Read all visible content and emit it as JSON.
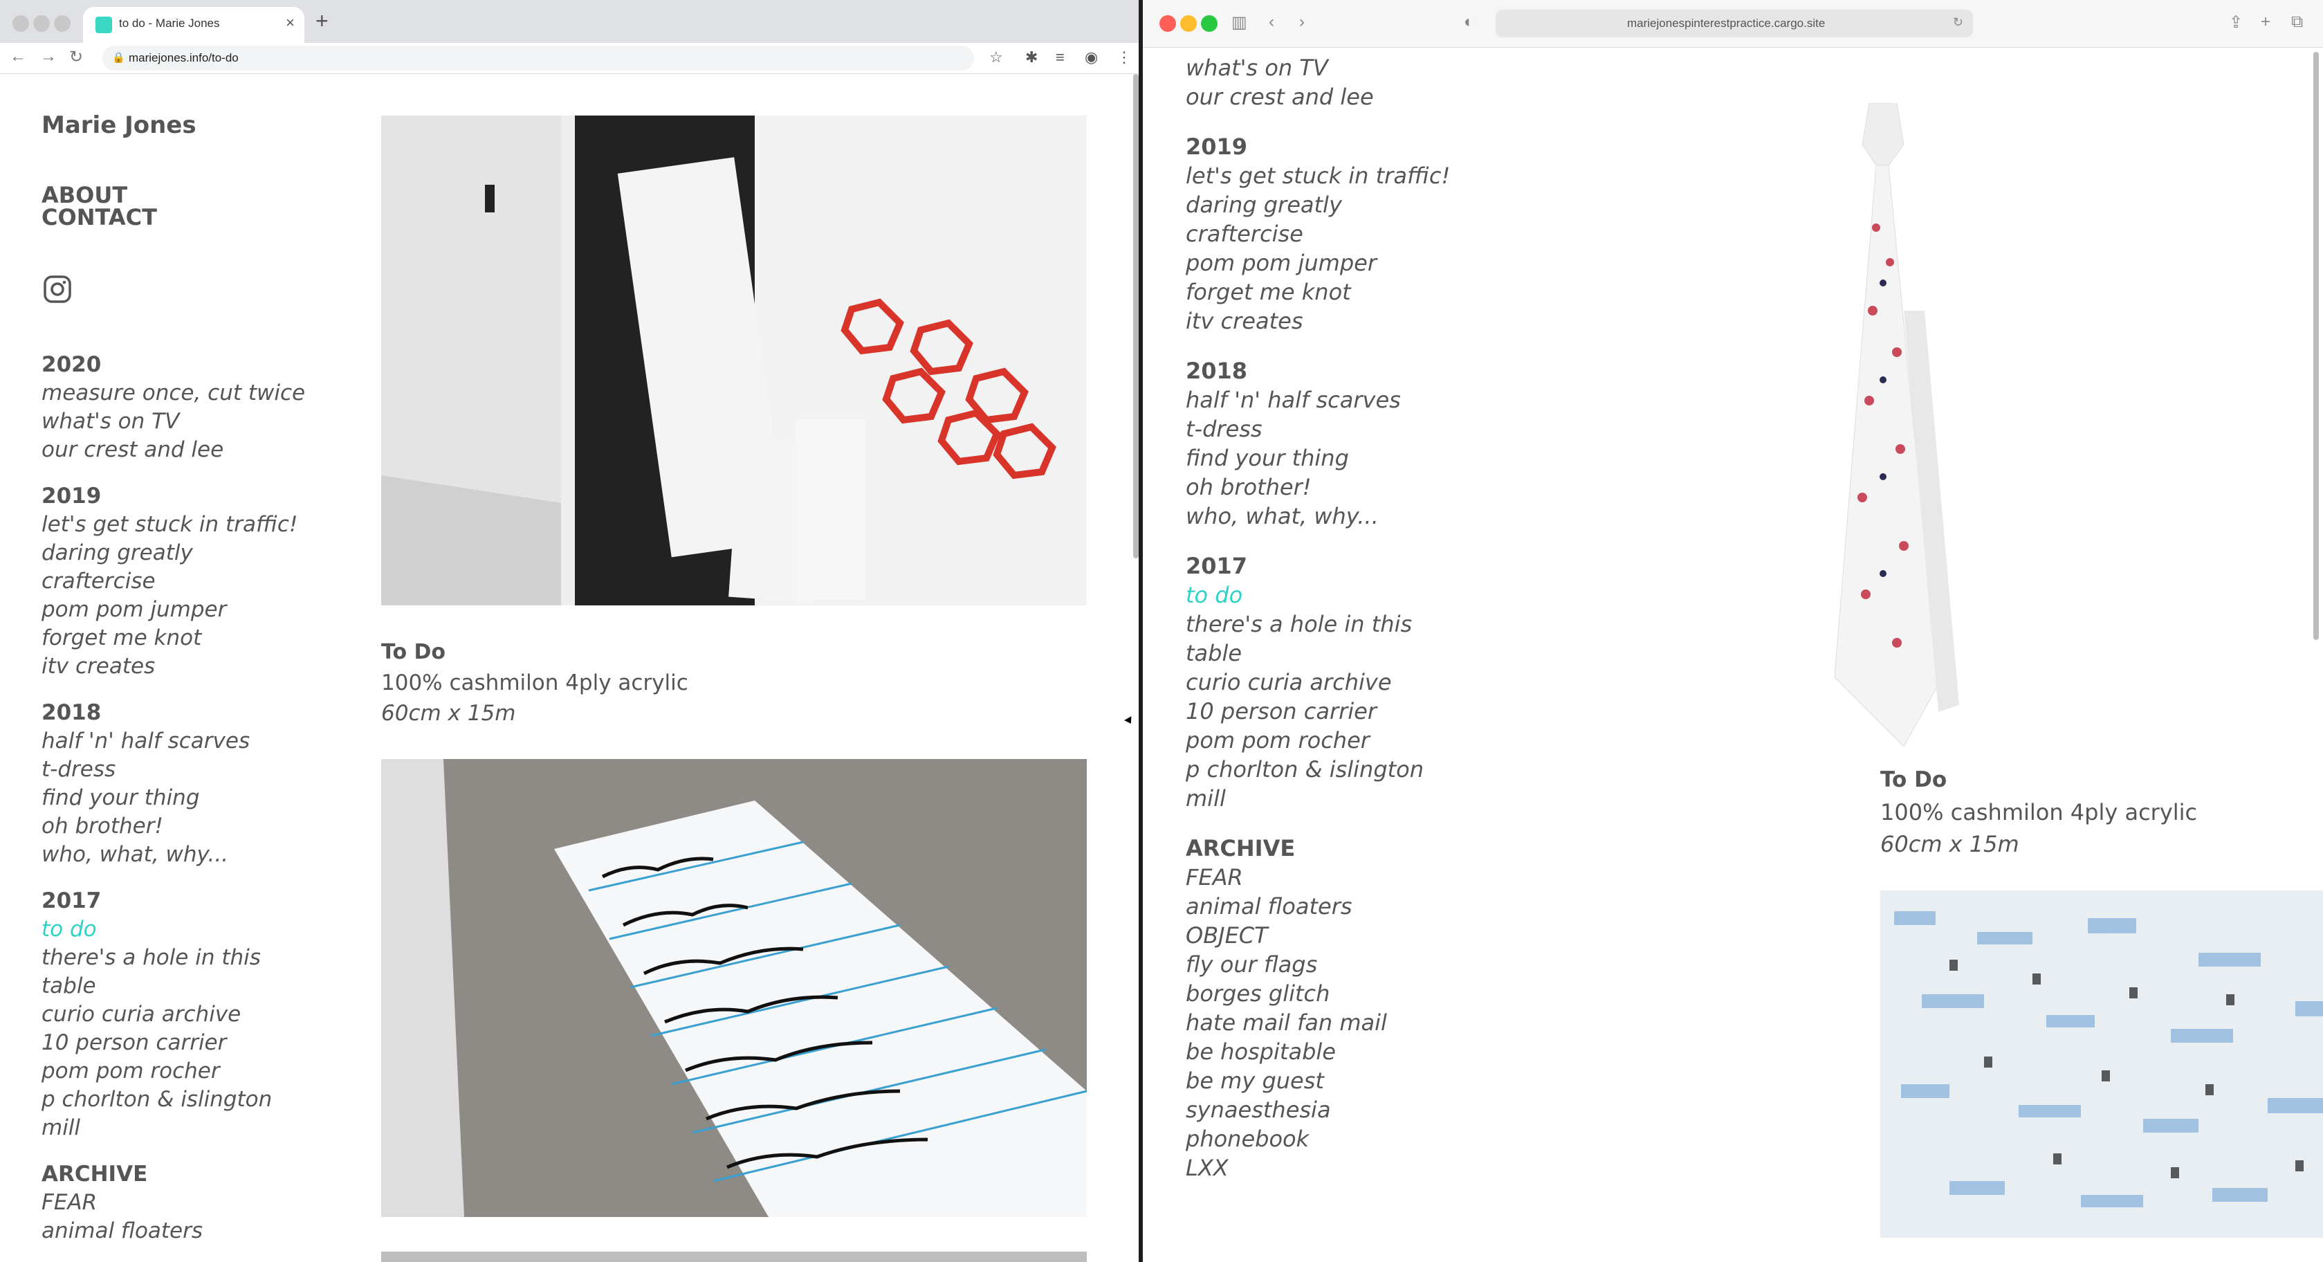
{
  "left_browser": {
    "tab_title": "to do - Marie Jones",
    "url": "mariejones.info/to-do"
  },
  "right_browser": {
    "url": "mariejonespinterestpractice.cargo.site"
  },
  "site": {
    "title": "Marie Jones",
    "nav": [
      "ABOUT",
      "CONTACT"
    ],
    "instagram_icon": "instagram-icon"
  },
  "sidebar_left": {
    "y2020": "2020",
    "items2020": [
      "measure once, cut twice",
      "what's on TV",
      "our crest and lee"
    ],
    "y2019": "2019",
    "items2019": [
      "let's get stuck in traffic!",
      "daring greatly",
      "craftercise",
      "pom pom jumper",
      "forget me knot",
      "itv creates"
    ],
    "y2018": "2018",
    "items2018": [
      "half 'n' half scarves",
      "t-dress",
      "find your thing",
      "oh brother!",
      "who, what, why..."
    ],
    "y2017": "2017",
    "items2017": [
      "to do",
      "there's a hole in this",
      "table",
      "curio curia archive",
      "10 person carrier",
      "pom pom rocher",
      "p chorlton & islington",
      "mill"
    ],
    "archive": "ARCHIVE",
    "archive_items": [
      "FEAR",
      "animal floaters"
    ]
  },
  "sidebar_right": {
    "items_top": [
      "what's on TV",
      "our crest and lee"
    ],
    "archive_items": [
      "FEAR",
      "animal floaters",
      "OBJECT",
      "fly our flags",
      "borges glitch",
      "hate mail fan mail",
      "be hospitable",
      "be my guest",
      "synaesthesia",
      "phonebook",
      "LXX"
    ]
  },
  "caption": {
    "title": "To Do",
    "material": "100% cashmilon 4ply acrylic",
    "size": "60cm x 15m"
  },
  "colors": {
    "accent": "#2fd3c5",
    "text": "#555555"
  }
}
